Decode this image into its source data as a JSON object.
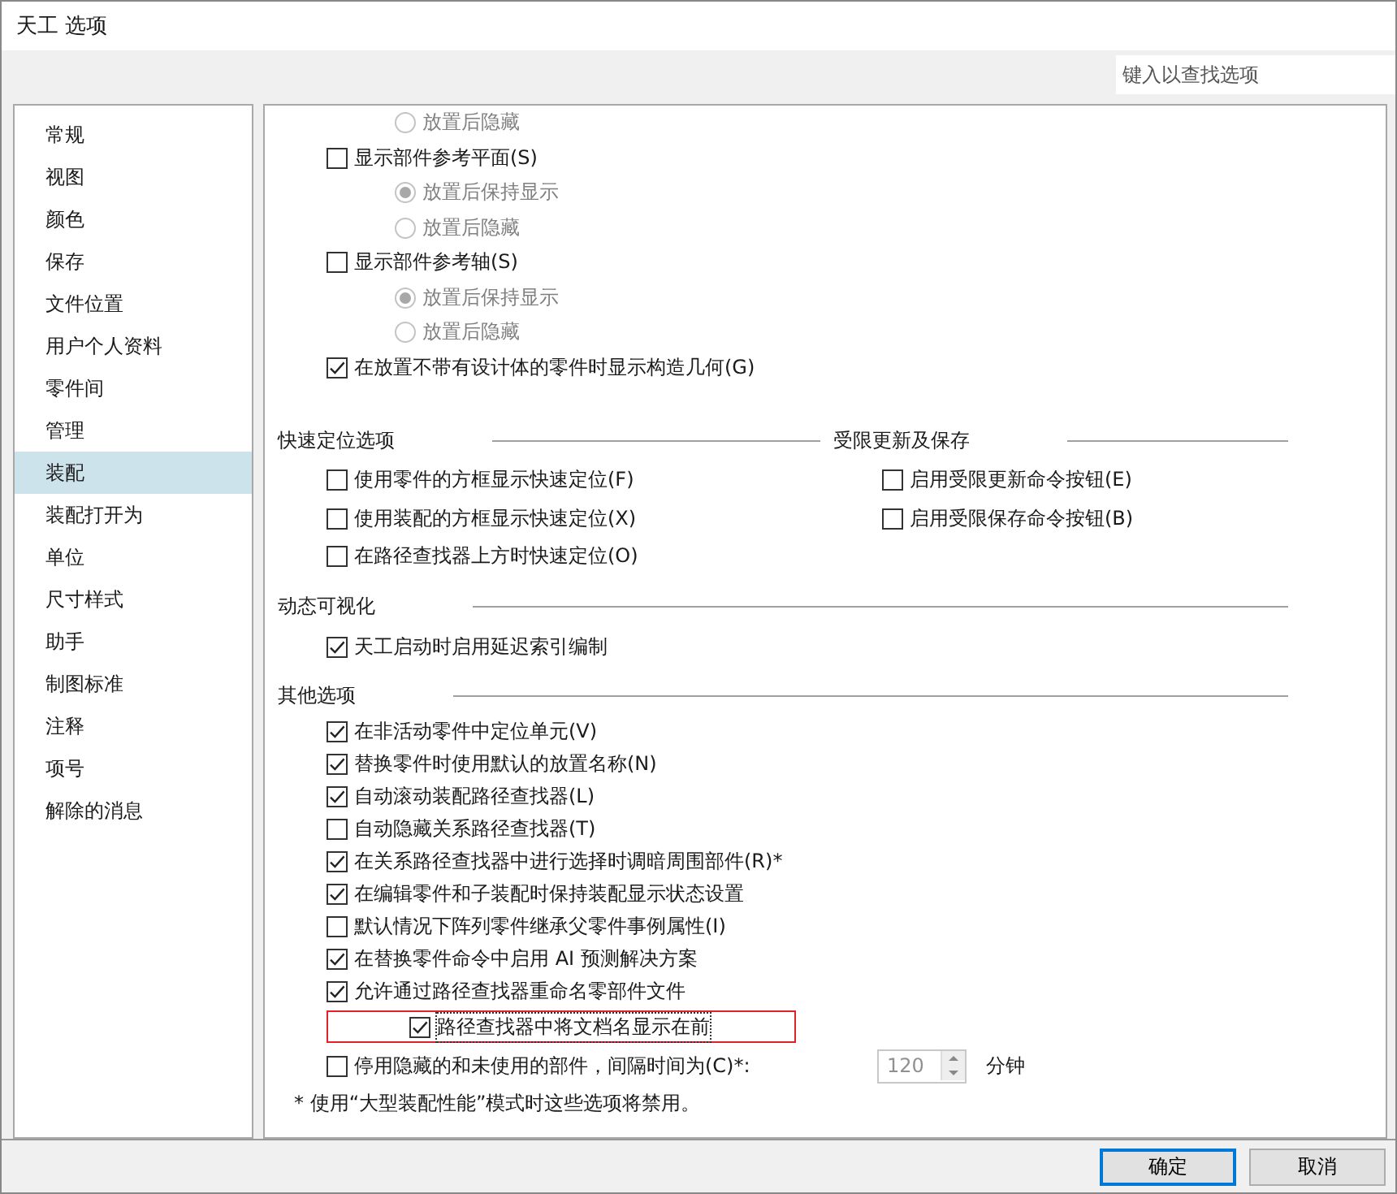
{
  "window": {
    "title": "天工 选项"
  },
  "search": {
    "placeholder": "键入以查找选项"
  },
  "sidebar": {
    "items": [
      {
        "label": "常规",
        "selected": false
      },
      {
        "label": "视图",
        "selected": false
      },
      {
        "label": "颜色",
        "selected": false
      },
      {
        "label": "保存",
        "selected": false
      },
      {
        "label": "文件位置",
        "selected": false
      },
      {
        "label": "用户个人资料",
        "selected": false
      },
      {
        "label": "零件间",
        "selected": false
      },
      {
        "label": "管理",
        "selected": false
      },
      {
        "label": "装配",
        "selected": true
      },
      {
        "label": "装配打开为",
        "selected": false
      },
      {
        "label": "单位",
        "selected": false
      },
      {
        "label": "尺寸样式",
        "selected": false
      },
      {
        "label": "助手",
        "selected": false
      },
      {
        "label": "制图标准",
        "selected": false
      },
      {
        "label": "注释",
        "selected": false
      },
      {
        "label": "项号",
        "selected": false
      },
      {
        "label": "解除的消息",
        "selected": false
      }
    ]
  },
  "top_options": [
    {
      "kind": "radio",
      "label": "放置后隐藏",
      "selected": false,
      "disabled": true
    },
    {
      "kind": "checkbox",
      "label": "显示部件参考平面(S)",
      "checked": false,
      "children": [
        {
          "kind": "radio",
          "label": "放置后保持显示",
          "selected": true,
          "disabled": true
        },
        {
          "kind": "radio",
          "label": "放置后隐藏",
          "selected": false,
          "disabled": true
        }
      ]
    },
    {
      "kind": "checkbox",
      "label": "显示部件参考轴(S)",
      "checked": false,
      "children": [
        {
          "kind": "radio",
          "label": "放置后保持显示",
          "selected": true,
          "disabled": true
        },
        {
          "kind": "radio",
          "label": "放置后隐藏",
          "selected": false,
          "disabled": true
        }
      ]
    },
    {
      "kind": "checkbox",
      "label": "在放置不带有设计体的零件时显示构造几何(G)",
      "checked": true
    }
  ],
  "quick_locate": {
    "title": "快速定位选项",
    "options": [
      {
        "kind": "checkbox",
        "label": "使用零件的方框显示快速定位(F)",
        "checked": false
      },
      {
        "kind": "checkbox",
        "label": "使用装配的方框显示快速定位(X)",
        "checked": false
      },
      {
        "kind": "checkbox",
        "label": "在路径查找器上方时快速定位(O)",
        "checked": false
      }
    ]
  },
  "restricted_update": {
    "title": "受限更新及保存",
    "options": [
      {
        "kind": "checkbox",
        "label": "启用受限更新命令按钮(E)",
        "checked": false
      },
      {
        "kind": "checkbox",
        "label": "启用受限保存命令按钮(B)",
        "checked": false
      }
    ]
  },
  "dynamic_visualization": {
    "title": "动态可视化",
    "options": [
      {
        "kind": "checkbox",
        "label": "天工启动时启用延迟索引编制",
        "checked": true
      }
    ]
  },
  "other_options": {
    "title": "其他选项",
    "options": [
      {
        "kind": "checkbox",
        "label": "在非活动零件中定位单元(V)",
        "checked": true
      },
      {
        "kind": "checkbox",
        "label": "替换零件时使用默认的放置名称(N)",
        "checked": true
      },
      {
        "kind": "checkbox",
        "label": "自动滚动装配路径查找器(L)",
        "checked": true
      },
      {
        "kind": "checkbox",
        "label": "自动隐藏关系路径查找器(T)",
        "checked": false
      },
      {
        "kind": "checkbox",
        "label": "在关系路径查找器中进行选择时调暗周围部件(R)*",
        "checked": true
      },
      {
        "kind": "checkbox",
        "label": "在编辑零件和子装配时保持装配显示状态设置",
        "checked": true
      },
      {
        "kind": "checkbox",
        "label": "默认情况下阵列零件继承父零件事例属性(I)",
        "checked": false
      },
      {
        "kind": "checkbox",
        "label": "在替换零件命令中启用 AI 预测解决方案",
        "checked": true
      },
      {
        "kind": "checkbox",
        "label": "允许通过路径查找器重命名零部件文件",
        "checked": true,
        "children": [
          {
            "kind": "checkbox",
            "label": "路径查找器中将文档名显示在前",
            "checked": true,
            "highlighted": true
          }
        ]
      }
    ]
  },
  "interval": {
    "label": "停用隐藏的和未使用的部件，间隔时间为(C)*:",
    "checked": false,
    "value": "120",
    "unit": "分钟"
  },
  "footnote": "* 使用“大型装配性能”模式时这些选项将禁用。",
  "buttons": [
    {
      "label": "确定",
      "default": true
    },
    {
      "label": "取消",
      "default": false
    }
  ]
}
